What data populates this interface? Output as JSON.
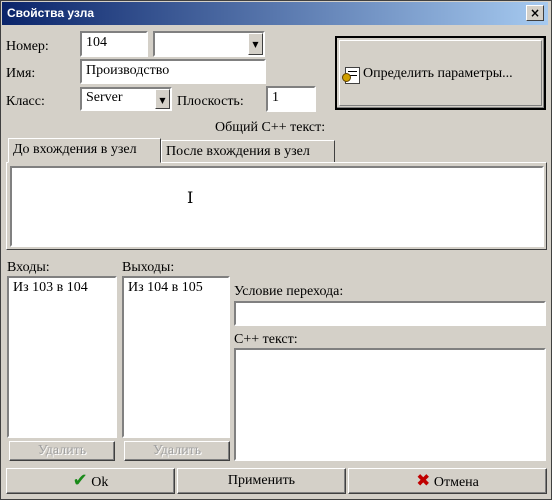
{
  "window": {
    "title": "Свойства узла",
    "close": "×"
  },
  "fields": {
    "number_label": "Номер:",
    "number_value": "104",
    "number_combo_value": "",
    "name_label": "Имя:",
    "name_value": "Производство",
    "class_label": "Класс:",
    "class_value": "Server",
    "plane_label": "Плоскость:",
    "plane_value": "1"
  },
  "define_params_button": "Определить параметры...",
  "common_cpp_label": "Общий С++ текст:",
  "tabs": [
    {
      "label": "До вхождения в узел",
      "active": true
    },
    {
      "label": "После вхождения в узел",
      "active": false
    }
  ],
  "inputs_panel": {
    "label": "Входы:",
    "items": [
      "Из 103 в 104"
    ],
    "delete_label": "Удалить"
  },
  "outputs_panel": {
    "label": "Выходы:",
    "items": [
      "Из 104 в 105"
    ],
    "delete_label": "Удалить"
  },
  "transition_label": "Условие перехода:",
  "cpp_text_label": "С++ текст:",
  "footer": {
    "ok": "Ok",
    "apply": "Применить",
    "cancel": "Отмена"
  },
  "colors": {
    "title_start": "#0a246a",
    "title_end": "#a6caf0",
    "ok_check": "#1a8a1a",
    "cancel_x": "#c00000"
  }
}
